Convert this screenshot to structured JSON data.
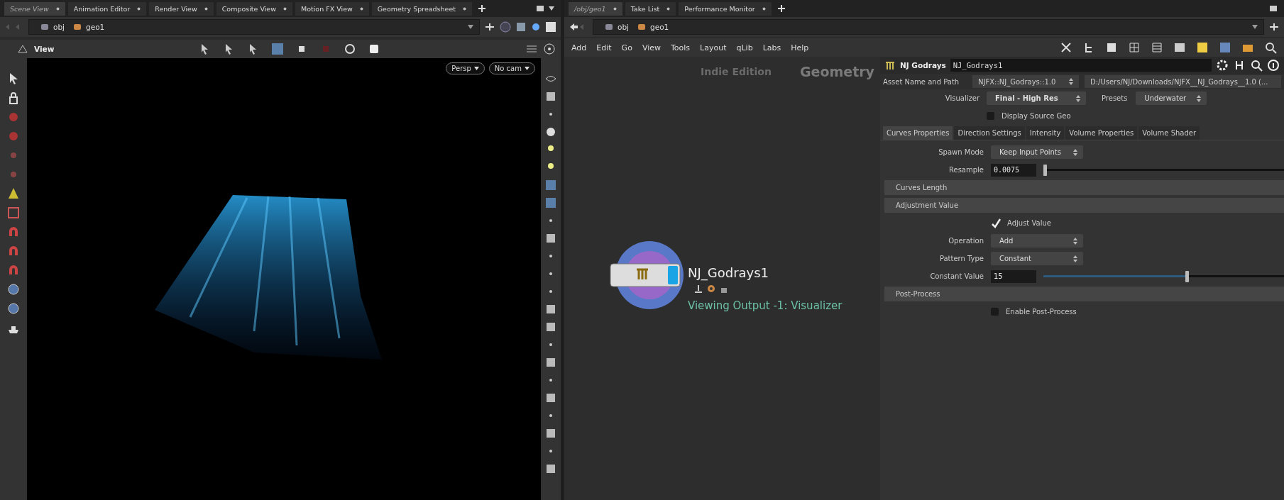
{
  "left_pane": {
    "tabs": [
      {
        "label": "Scene View",
        "selected": true
      },
      {
        "label": "Animation Editor",
        "selected": false
      },
      {
        "label": "Render View",
        "selected": false
      },
      {
        "label": "Composite View",
        "selected": false
      },
      {
        "label": "Motion FX View",
        "selected": false
      },
      {
        "label": "Geometry Spreadsheet",
        "selected": false
      }
    ],
    "path": [
      "obj",
      "geo1"
    ],
    "viewer_title": "View",
    "view_menus": [
      "Persp",
      "No cam"
    ]
  },
  "right_pane": {
    "tabs": [
      {
        "label": "/obj/geo1",
        "selected": true
      },
      {
        "label": "Take List",
        "selected": false
      },
      {
        "label": "Performance Monitor",
        "selected": false
      }
    ],
    "path": [
      "obj",
      "geo1"
    ],
    "menu": [
      "Add",
      "Edit",
      "Go",
      "View",
      "Tools",
      "Layout",
      "qLib",
      "Labs",
      "Help"
    ],
    "network": {
      "edition_label": "Indie Edition",
      "context_label": "Geometry",
      "node": {
        "name": "NJ_Godrays1",
        "status": "Viewing Output -1: Visualizer"
      }
    }
  },
  "parameters": {
    "type_label": "NJ Godrays",
    "node_name": "NJ_Godrays1",
    "asset_label": "Asset Name and Path",
    "asset_name": "NJFX::NJ_Godrays::1.0",
    "asset_path": "D:/Users/NJ/Downloads/NJFX__NJ_Godrays__1.0 (...",
    "visualizer": {
      "label": "Visualizer",
      "value": "Final - High Res"
    },
    "presets": {
      "label": "Presets",
      "value": "Underwater"
    },
    "display_source": {
      "label": "Display Source Geo",
      "checked": false
    },
    "tabs": [
      {
        "label": "Curves Properties",
        "selected": true
      },
      {
        "label": "Direction Settings",
        "selected": false
      },
      {
        "label": "Intensity",
        "selected": false
      },
      {
        "label": "Volume Properties",
        "selected": false
      },
      {
        "label": "Volume Shader",
        "selected": false
      }
    ],
    "rows": [
      {
        "kind": "menu",
        "label": "Spawn Mode",
        "value": "Keep Input Points"
      },
      {
        "kind": "slider",
        "label": "Resample",
        "value": "0.0075",
        "level": 0.01
      },
      {
        "kind": "section",
        "label": "Curves Length"
      },
      {
        "kind": "section",
        "label": "Adjustment Value"
      },
      {
        "kind": "toggle",
        "label": "Adjust Value",
        "checked": true
      },
      {
        "kind": "menu",
        "label": "Operation",
        "value": "Add"
      },
      {
        "kind": "menu",
        "label": "Pattern Type",
        "value": "Constant"
      },
      {
        "kind": "slider",
        "label": "Constant Value",
        "value": "15",
        "level": 0.6
      },
      {
        "kind": "section",
        "label": "Post-Process"
      },
      {
        "kind": "toggle",
        "label": "Enable Post-Process",
        "checked": false
      }
    ]
  }
}
